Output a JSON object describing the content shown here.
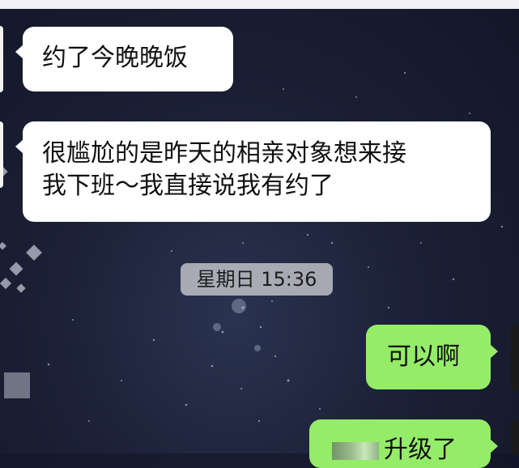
{
  "chat": {
    "messages": [
      {
        "side": "left",
        "text": "约了今晚晚饭"
      },
      {
        "side": "left",
        "lines": [
          "很尴尬的是昨天的相亲对象想来接",
          "我下班～我直接说我有约了"
        ]
      },
      {
        "side": "right",
        "text": "可以啊"
      },
      {
        "side": "right",
        "text": "升级了"
      }
    ],
    "timestamp": "星期日 15:36"
  },
  "colors": {
    "incoming_bubble": "#ffffff",
    "outgoing_bubble": "#95ec69",
    "background": "#1b2036"
  }
}
